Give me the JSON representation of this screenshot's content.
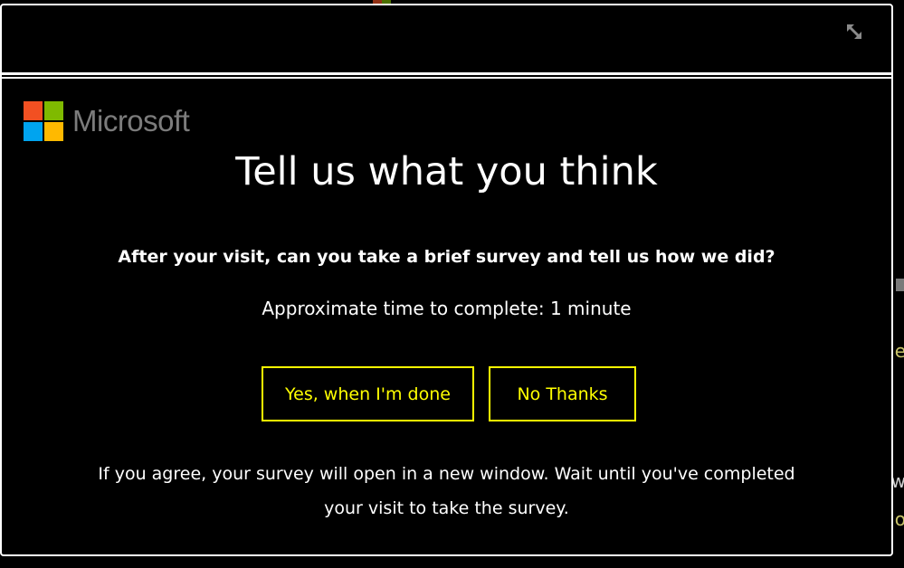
{
  "dialog": {
    "brand": {
      "name": "Microsoft",
      "logo_colors": [
        "#f25022",
        "#7fba00",
        "#00a4ef",
        "#ffb900"
      ]
    },
    "close_icon": "resize-diagonal-icon",
    "title": "Tell us what you think",
    "question": "After your visit, can you take a brief survey and tell us how we did?",
    "time_estimate": "Approximate time to complete: 1 minute",
    "buttons": {
      "yes": "Yes, when I'm done",
      "no": "No Thanks"
    },
    "note_line1": "If you agree, your survey will open in a new window. Wait until you've completed",
    "note_line2": "your visit to take the survey."
  },
  "colors": {
    "background": "#000000",
    "text": "#ffffff",
    "button_accent": "#ffff00",
    "brand_text": "#7c7c7c"
  }
}
